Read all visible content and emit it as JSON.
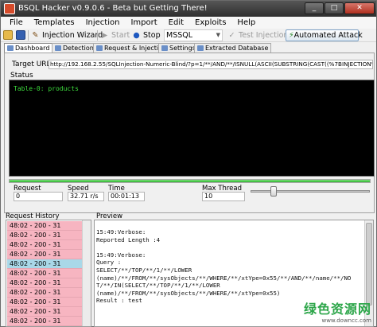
{
  "window": {
    "title": "BSQL Hacker v0.9.0.6 - Beta but Getting There!",
    "controls": [
      "_",
      "□",
      "✕"
    ]
  },
  "menu": [
    "File",
    "Templates",
    "Injection",
    "Import",
    "Edit",
    "Exploits",
    "Help"
  ],
  "toolbar": {
    "wizard": "Injection Wizard",
    "start": "Start",
    "stop": "Stop",
    "db_type": "MSSQL",
    "test": "Test Injection",
    "auto": "Automated Attack"
  },
  "tabs": [
    "Dashboard",
    "Detection",
    "Request & Injection",
    "Settings",
    "Extracted Database"
  ],
  "target": {
    "label": "Target URL :",
    "url": "http://192.168.2.55/SQLInjection-Numeric-Blind/?p=1/**/AND/**/ISNULL(ASCII(SUBSTRING(CAST((%7BINJECTION%7D"
  },
  "status": {
    "label": "Status",
    "text": "Table-0: products"
  },
  "progress": {
    "fraction": 1.0
  },
  "stats": {
    "request_label": "Request",
    "request_value": "0",
    "speed_label": "Speed",
    "speed_value": "32.71 r/s",
    "time_label": "Time",
    "time_value": "00:01:13",
    "thread_label": "Max Thread",
    "thread_value": "10"
  },
  "history": {
    "label": "Request History",
    "items": [
      "48:02 - 200 - 31",
      "48:02 - 200 - 31",
      "48:02 - 200 - 31",
      "48:02 - 200 - 31",
      "48:02 - 200 - 31",
      "48:02 - 200 - 31",
      "48:02 - 200 - 31",
      "48:02 - 200 - 31",
      "48:02 - 200 - 31",
      "48:02 - 200 - 31",
      "48:02 - 200 - 31"
    ],
    "selected_index": 4
  },
  "preview": {
    "label": "Preview",
    "lines": [
      "15:49:Verbose:",
      "Reported Length :4",
      "",
      "15:49:Verbose:",
      "Query :",
      "SELECT/**/TOP/**/1/**/LOWER",
      "(name)/**/FROM/**/sysObjects/**/WHERE/**/xtYpe=0x55/**/AND/**/name/**/NO",
      "T/**/IN(SELECT/**/TOP/**/1/**/LOWER",
      "(name)/**/FROM/**/sysObjects/**/WHERE/**/xtYpe=0x55)",
      "Result : test"
    ]
  },
  "watermark": {
    "main": "绿色资源网",
    "sub": "www.downcc.com"
  },
  "colors": {
    "history_row": "#f7b5c1",
    "history_selected": "#a9d8e8",
    "status_text": "#3ddc3d",
    "progress": "#2fb52f"
  }
}
